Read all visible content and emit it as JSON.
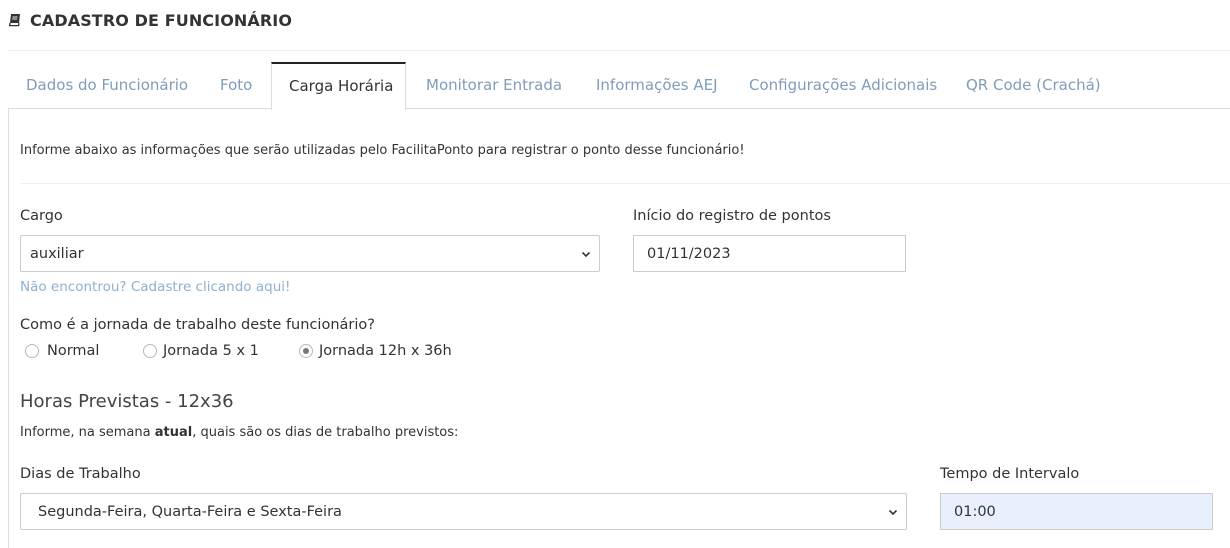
{
  "header": {
    "title": "CADASTRO DE FUNCIONÁRIO",
    "icon": "book-icon"
  },
  "tabs": [
    {
      "label": "Dados do Funcionário",
      "active": false
    },
    {
      "label": "Foto",
      "active": false
    },
    {
      "label": "Carga Horária",
      "active": true
    },
    {
      "label": "Monitorar Entrada",
      "active": false
    },
    {
      "label": "Informações AEJ",
      "active": false
    },
    {
      "label": "Configurações Adicionais",
      "active": false
    },
    {
      "label": "QR Code (Crachá)",
      "active": false
    }
  ],
  "intro_text": "Informe abaixo as informações que serão utilizadas pelo FacilitaPonto para registrar o ponto desse funcionário!",
  "cargo": {
    "label": "Cargo",
    "value": "auxiliar",
    "register_link": "Não encontrou? Cadastre clicando aqui!"
  },
  "inicio": {
    "label": "Início do registro de pontos",
    "value": "01/11/2023"
  },
  "jornada": {
    "question": "Como é a jornada de trabalho deste funcionário?",
    "options": [
      {
        "label": "Normal",
        "checked": false
      },
      {
        "label": "Jornada 5 x 1",
        "checked": false
      },
      {
        "label": "Jornada 12h x 36h",
        "checked": true
      }
    ]
  },
  "horas": {
    "title": "Horas Previstas - 12x36",
    "desc_before": "Informe, na semana ",
    "desc_bold": "atual",
    "desc_after": ", quais são os dias de trabalho previstos:"
  },
  "dias": {
    "label": "Dias de Trabalho",
    "value": "Segunda-Feira, Quarta-Feira e Sexta-Feira"
  },
  "intervalo": {
    "label": "Tempo de Intervalo",
    "value": "01:00"
  },
  "colors": {
    "link": "#8fb0cf",
    "tab_inactive": "#7f9db9",
    "autofill_bg": "#e8f0fe"
  }
}
